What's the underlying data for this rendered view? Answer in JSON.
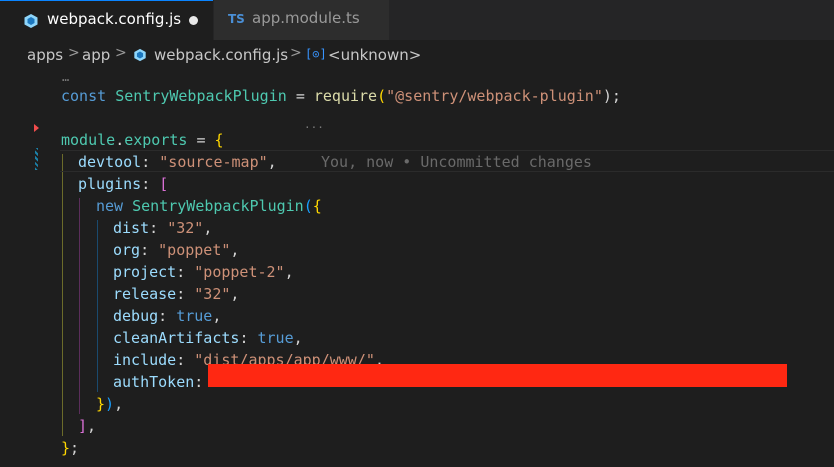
{
  "tabs": [
    {
      "label": "webpack.config.js",
      "icon": "webpack-icon",
      "active": true,
      "dirty": true
    },
    {
      "label": "app.module.ts",
      "icon": "typescript-icon",
      "badge": "TS",
      "active": false
    }
  ],
  "breadcrumb": {
    "items": [
      "apps",
      "app",
      "webpack.config.js",
      "<unknown>"
    ],
    "separator": ">"
  },
  "editor": {
    "folded_marker": "…",
    "blame": "You, now • Uncommitted changes",
    "lines": {
      "l1": {
        "kw": "const",
        "name": "SentryWebpackPlugin",
        "eq": "=",
        "fn": "require",
        "open": "(",
        "arg": "\"@sentry/webpack-plugin\"",
        "close": ");"
      },
      "l3": {
        "obj": "module",
        "dot": ".",
        "prop": "exports",
        "eq": "=",
        "brace": "{"
      },
      "l4": {
        "key": "devtool",
        "colon": ":",
        "val": "\"source-map\"",
        "comma": ","
      },
      "l5": {
        "key": "plugins",
        "colon": ":",
        "bracket": "["
      },
      "l6": {
        "kw": "new",
        "name": "SentryWebpackPlugin",
        "paren": "(",
        "brace": "{"
      },
      "l7": {
        "key": "dist",
        "colon": ":",
        "val": "\"32\"",
        "comma": ","
      },
      "l8": {
        "key": "org",
        "colon": ":",
        "val": "\"poppet\"",
        "comma": ","
      },
      "l9": {
        "key": "project",
        "colon": ":",
        "val": "\"poppet-2\"",
        "comma": ","
      },
      "l10": {
        "key": "release",
        "colon": ":",
        "val": "\"32\"",
        "comma": ","
      },
      "l11": {
        "key": "debug",
        "colon": ":",
        "val": "true",
        "comma": ","
      },
      "l12": {
        "key": "cleanArtifacts",
        "colon": ":",
        "val": "true",
        "comma": ","
      },
      "l13": {
        "key": "include",
        "colon": ":",
        "val": "\"dist/apps/app/www/\"",
        "comma": ","
      },
      "l14": {
        "key": "authToken",
        "colon": ":"
      },
      "l15": {
        "brace": "}",
        "paren": ")",
        "comma": ","
      },
      "l16": {
        "bracket": "]",
        "comma": ","
      },
      "l17": {
        "brace": "}",
        "semi": ";"
      }
    }
  },
  "colors": {
    "redaction": "#ff2812",
    "keyword": "#569cd6",
    "string": "#ce9178",
    "property": "#9cdcfe"
  }
}
